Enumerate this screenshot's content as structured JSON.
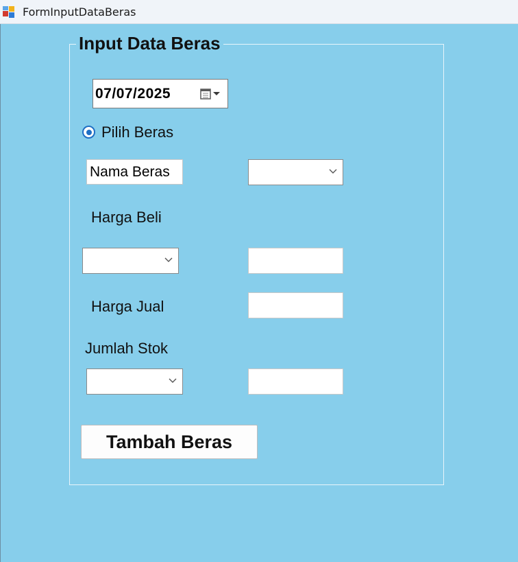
{
  "window": {
    "title": "FormInputDataBeras"
  },
  "group": {
    "title": "Input Data Beras"
  },
  "date_picker": {
    "value": "07/07/2025"
  },
  "radio": {
    "label": "Pilih Beras"
  },
  "fields": {
    "nama_beras": "Nama Beras",
    "harga_beli_label": "Harga Beli",
    "harga_jual_label": "Harga Jual",
    "jumlah_stok_label": "Jumlah Stok"
  },
  "button": {
    "label": "Tambah Beras"
  },
  "icons": [
    "app-icon",
    "calendar-icon",
    "chevron-down-icon"
  ],
  "colors": {
    "background": "#87ceeb",
    "radio_accent": "#1f6fc4"
  }
}
